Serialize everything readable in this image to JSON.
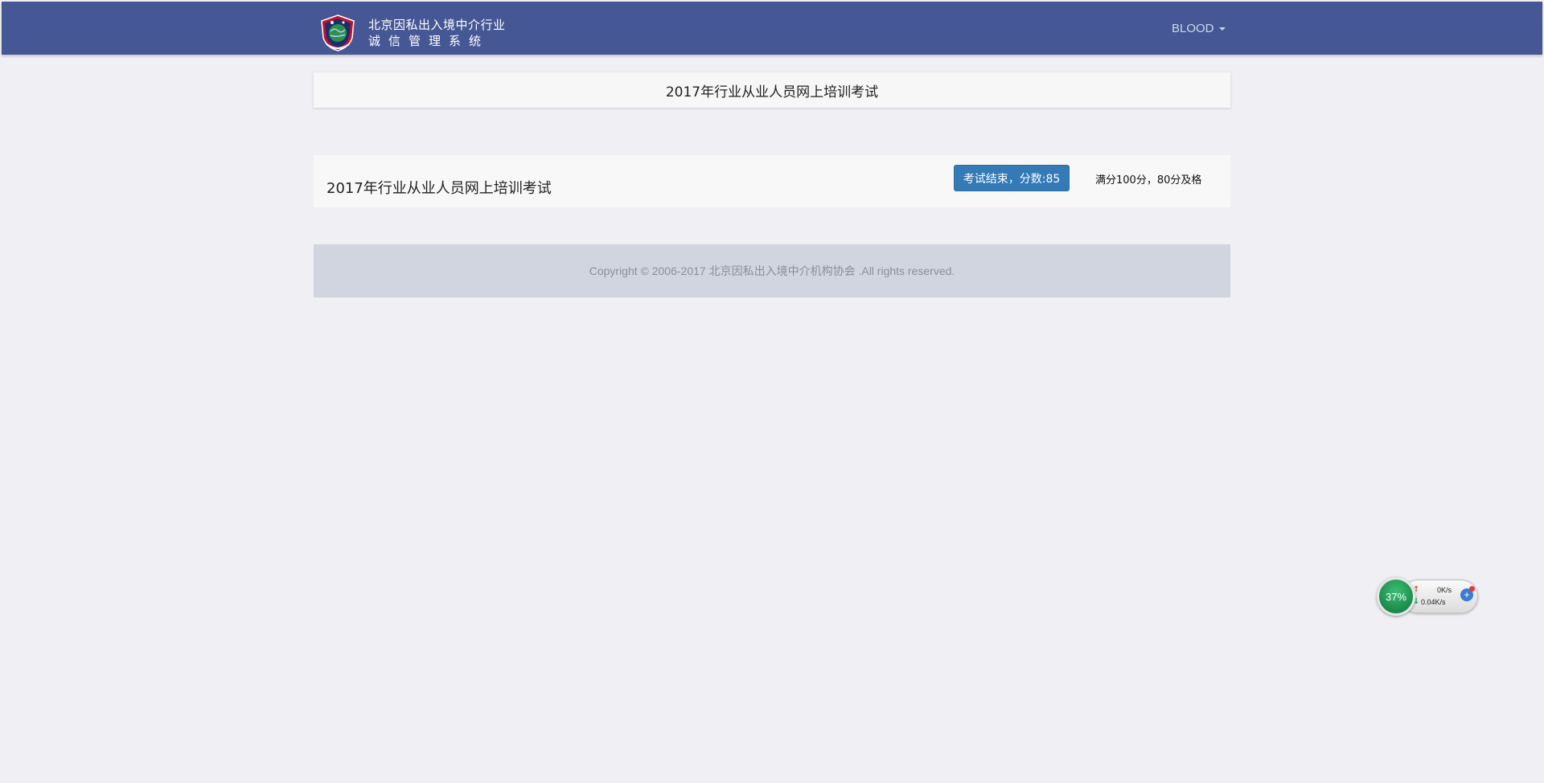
{
  "header": {
    "brand_line1": "北京因私出入境中介行业",
    "brand_line2": "诚信管理系统",
    "user_name": "BLOOD",
    "logo_icon": "shield-globe-logo",
    "color": "#455794"
  },
  "title_panel": {
    "title": "2017年行业从业人员网上培训考试"
  },
  "exam": {
    "name": "2017年行业从业人员网上培训考试",
    "result_label": "考试结束，分数:85",
    "pass_note": "满分100分，80分及格",
    "button_color": "#337ab7"
  },
  "footer": {
    "copyright": "Copyright © 2006-2017 北京因私出入境中介机构协会 .All rights reserved."
  },
  "net_widget": {
    "percent": "37%",
    "upload": "0K/s",
    "download": "0.04K/s",
    "up_icon": "up-arrow-icon",
    "down_icon": "down-arrow-icon",
    "plus_label": "+"
  }
}
